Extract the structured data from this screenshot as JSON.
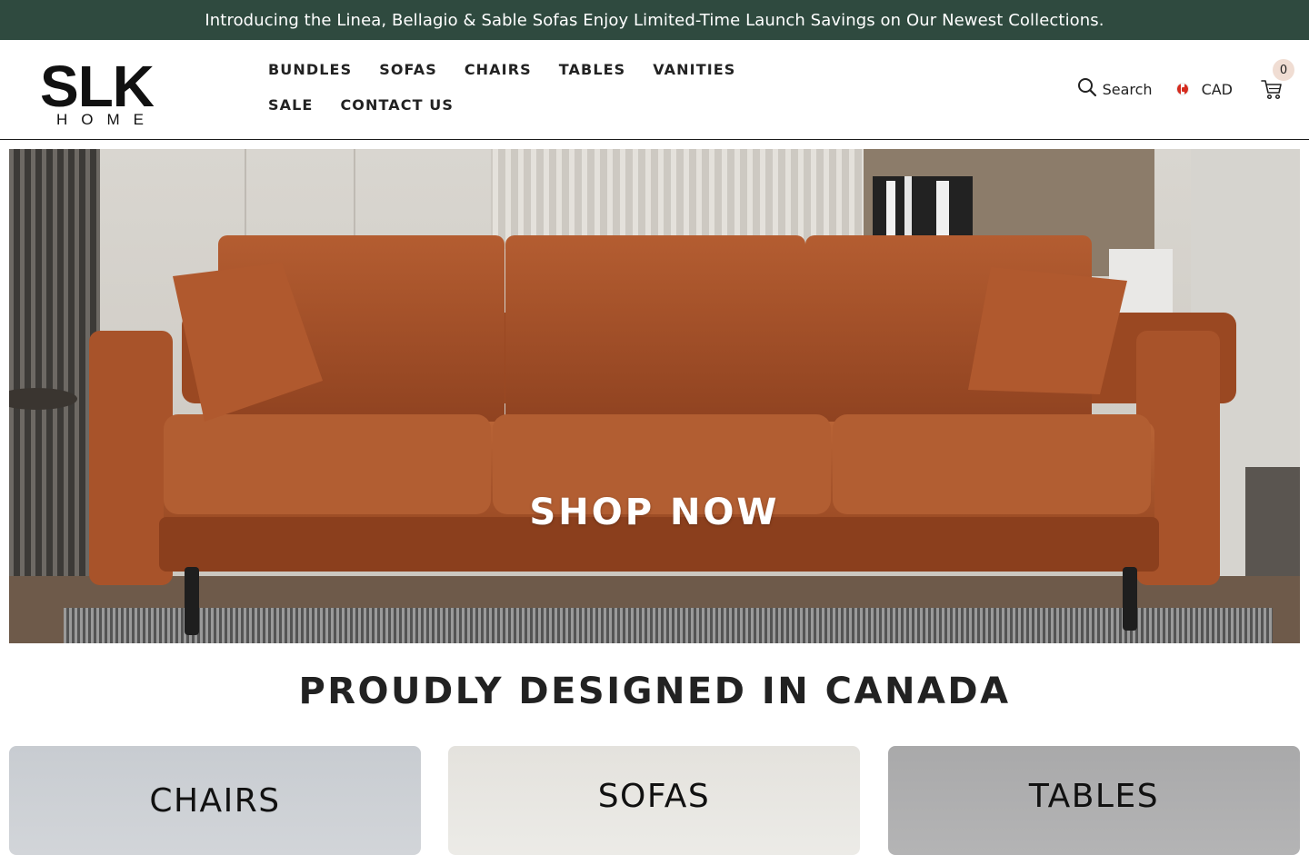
{
  "announcement": {
    "text": "Introducing the Linea, Bellagio & Sable Sofas Enjoy Limited-Time Launch Savings on Our Newest Collections."
  },
  "logo": {
    "main": "SLK",
    "sub": "HOME"
  },
  "nav": {
    "items": [
      "BUNDLES",
      "SOFAS",
      "CHAIRS",
      "TABLES",
      "VANITIES",
      "SALE",
      "CONTACT US"
    ]
  },
  "header": {
    "search_label": "Search",
    "currency_label": "CAD",
    "cart_count": "0",
    "search_icon": "search-icon",
    "cart_icon": "cart-icon",
    "flag_icon": "canada-flag-icon"
  },
  "hero": {
    "cta_label": "SHOP NOW"
  },
  "section": {
    "title": "PROUDLY DESIGNED IN CANADA"
  },
  "categories": [
    {
      "label": "CHAIRS"
    },
    {
      "label": "SOFAS"
    },
    {
      "label": "TABLES"
    }
  ],
  "colors": {
    "announcement_bg": "#2f4a3f",
    "cart_badge_bg": "#f0ddd3",
    "sofa_leather": "#a9532a"
  }
}
